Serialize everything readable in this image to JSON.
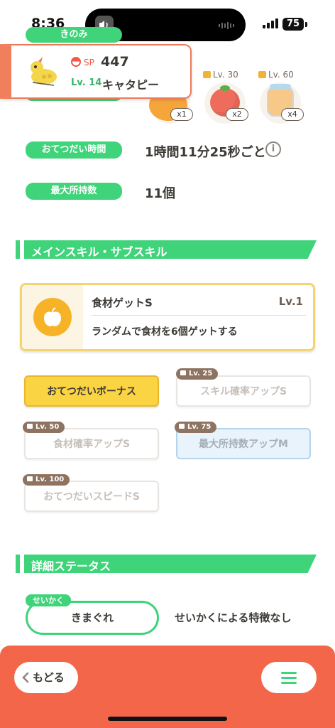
{
  "status": {
    "time": "8:36",
    "battery": "75"
  },
  "top": {
    "kinomi_label": "きのみ",
    "ingredients": [
      {
        "lock_level": "",
        "count": "x1",
        "icon": "apple-ingredient"
      },
      {
        "lock_level": "Lv. 30",
        "count": "x2",
        "icon": "tomato-ingredient"
      },
      {
        "lock_level": "Lv. 60",
        "count": "x4",
        "icon": "honey-jar-ingredient"
      }
    ]
  },
  "popup": {
    "sp_label": "SP",
    "sp_value": "447",
    "level": "Lv. 14",
    "name": "キャタピー"
  },
  "info": {
    "help_time_label": "おてつだい時間",
    "help_time_value": "1時間11分25秒ごと",
    "max_carry_label": "最大所持数",
    "max_carry_value": "11個"
  },
  "skills_section": {
    "title": "メインスキル・サブスキル",
    "main_skill": {
      "name": "食材ゲットS",
      "level": "Lv.1",
      "description": "ランダムで食材を6個ゲットする"
    },
    "sub_skills": [
      {
        "label": "おてつだいボーナス",
        "lock": ""
      },
      {
        "label": "スキル確率アップS",
        "lock": "Lv. 25"
      },
      {
        "label": "食材確率アップS",
        "lock": "Lv. 50"
      },
      {
        "label": "最大所持数アップM",
        "lock": "Lv. 75"
      },
      {
        "label": "おてつだいスピードS",
        "lock": "Lv. 100"
      }
    ]
  },
  "details_section": {
    "title": "詳細ステータス",
    "nature_tag": "せいかく",
    "nature_value": "きまぐれ",
    "nature_desc": "せいかくによる特徴なし"
  },
  "bottom": {
    "back_label": "もどる"
  }
}
